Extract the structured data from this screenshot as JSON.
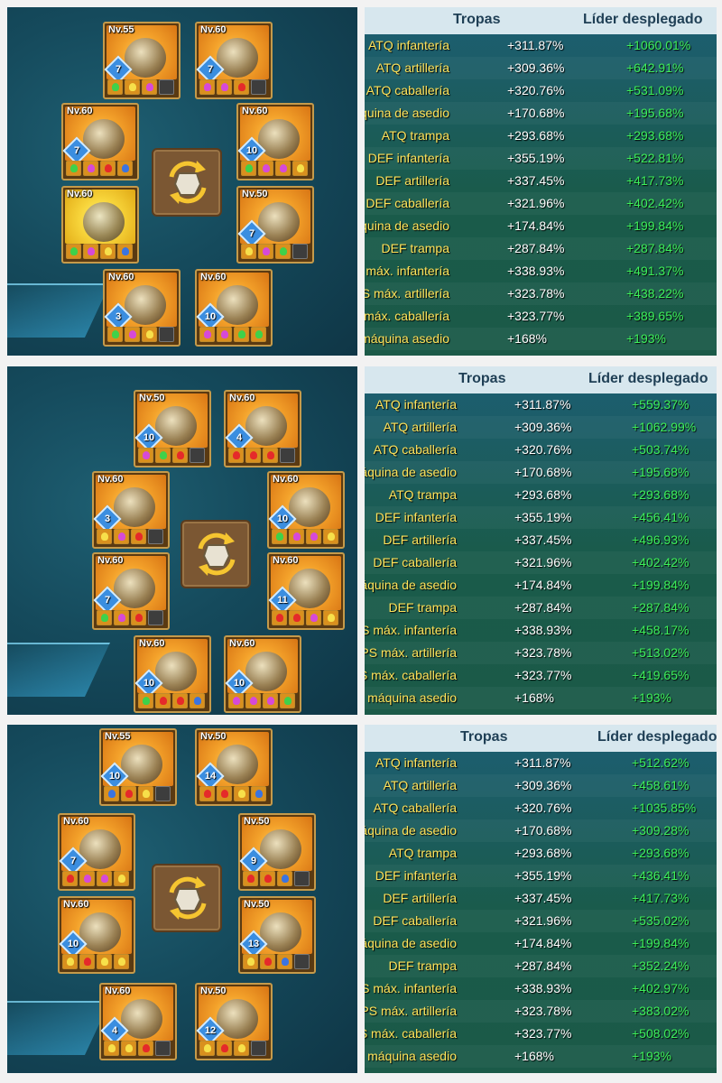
{
  "icons": {
    "swap": "swap-icon",
    "chest_armor": "armor-icon"
  },
  "colors": {
    "label": "#ffe35a",
    "troop_value": "#ffffff",
    "leader_value": "#3df05a",
    "header_text": "#1f3f55"
  },
  "panels": [
    {
      "slots": [
        {
          "level": "Nv.55",
          "stars": "7"
        },
        {
          "level": "Nv.60",
          "stars": "7"
        },
        {
          "level": "Nv.60",
          "stars": "7"
        },
        {
          "level": "Nv.60",
          "stars": "10"
        },
        {
          "level": "Nv.60",
          "stars": ""
        },
        {
          "level": "Nv.50",
          "stars": "7"
        },
        {
          "level": "Nv.60",
          "stars": "3"
        },
        {
          "level": "Nv.60",
          "stars": "10"
        }
      ],
      "table": {
        "header_troops": "Tropas",
        "header_leader": "Líder desplegado",
        "rows": [
          {
            "label": "ATQ infantería",
            "troops": "+311.87%",
            "leader": "+1060.01%"
          },
          {
            "label": "ATQ artillería",
            "troops": "+309.36%",
            "leader": "+642.91%"
          },
          {
            "label": "ATQ caballería",
            "troops": "+320.76%",
            "leader": "+531.09%"
          },
          {
            "label": "áquina de asedio",
            "troops": "+170.68%",
            "leader": "+195.68%"
          },
          {
            "label": "ATQ trampa",
            "troops": "+293.68%",
            "leader": "+293.68%"
          },
          {
            "label": "DEF infantería",
            "troops": "+355.19%",
            "leader": "+522.81%"
          },
          {
            "label": "DEF artillería",
            "troops": "+337.45%",
            "leader": "+417.73%"
          },
          {
            "label": "DEF caballería",
            "troops": "+321.96%",
            "leader": "+402.42%"
          },
          {
            "label": "áquina de asedio",
            "troops": "+174.84%",
            "leader": "+199.84%"
          },
          {
            "label": "DEF trampa",
            "troops": "+287.84%",
            "leader": "+287.84%"
          },
          {
            "label": "máx. infantería",
            "troops": "+338.93%",
            "leader": "+491.37%"
          },
          {
            "label": "PS máx. artillería",
            "troops": "+323.78%",
            "leader": "+438.22%"
          },
          {
            "label": "máx. caballería",
            "troops": "+323.77%",
            "leader": "+389.65%"
          },
          {
            "label": "máquina asedio",
            "troops": "+168%",
            "leader": "+193%"
          }
        ]
      }
    },
    {
      "slots": [
        {
          "level": "Nv.50",
          "stars": "10"
        },
        {
          "level": "Nv.60",
          "stars": "4"
        },
        {
          "level": "Nv.60",
          "stars": "3"
        },
        {
          "level": "Nv.60",
          "stars": "10"
        },
        {
          "level": "Nv.60",
          "stars": "7"
        },
        {
          "level": "Nv.60",
          "stars": "11"
        },
        {
          "level": "Nv.60",
          "stars": "10"
        },
        {
          "level": "Nv.60",
          "stars": "10"
        }
      ],
      "table": {
        "header_troops": "Tropas",
        "header_leader": "Líder desplegado",
        "rows": [
          {
            "label": "ATQ infantería",
            "troops": "+311.87%",
            "leader": "+559.37%"
          },
          {
            "label": "ATQ artillería",
            "troops": "+309.36%",
            "leader": "+1062.99%"
          },
          {
            "label": "ATQ caballería",
            "troops": "+320.76%",
            "leader": "+503.74%"
          },
          {
            "label": "áquina de asedio",
            "troops": "+170.68%",
            "leader": "+195.68%"
          },
          {
            "label": "ATQ trampa",
            "troops": "+293.68%",
            "leader": "+293.68%"
          },
          {
            "label": "DEF infantería",
            "troops": "+355.19%",
            "leader": "+456.41%"
          },
          {
            "label": "DEF artillería",
            "troops": "+337.45%",
            "leader": "+496.93%"
          },
          {
            "label": "DEF caballería",
            "troops": "+321.96%",
            "leader": "+402.42%"
          },
          {
            "label": "áquina de asedio",
            "troops": "+174.84%",
            "leader": "+199.84%"
          },
          {
            "label": "DEF trampa",
            "troops": "+287.84%",
            "leader": "+287.84%"
          },
          {
            "label": "PS máx. infantería",
            "troops": "+338.93%",
            "leader": "+458.17%"
          },
          {
            "label": "PS máx. artillería",
            "troops": "+323.78%",
            "leader": "+513.02%"
          },
          {
            "label": "PS máx. caballería",
            "troops": "+323.77%",
            "leader": "+419.65%"
          },
          {
            "label": "máquina asedio",
            "troops": "+168%",
            "leader": "+193%"
          }
        ]
      }
    },
    {
      "slots": [
        {
          "level": "Nv.55",
          "stars": "10"
        },
        {
          "level": "Nv.50",
          "stars": "14"
        },
        {
          "level": "Nv.60",
          "stars": "7"
        },
        {
          "level": "Nv.50",
          "stars": "9"
        },
        {
          "level": "Nv.60",
          "stars": "10"
        },
        {
          "level": "Nv.50",
          "stars": "13"
        },
        {
          "level": "Nv.60",
          "stars": "4"
        },
        {
          "level": "Nv.50",
          "stars": "12"
        }
      ],
      "table": {
        "header_troops": "Tropas",
        "header_leader": "Líder desplegado",
        "rows": [
          {
            "label": "ATQ infantería",
            "troops": "+311.87%",
            "leader": "+512.62%"
          },
          {
            "label": "ATQ artillería",
            "troops": "+309.36%",
            "leader": "+458.61%"
          },
          {
            "label": "ATQ caballería",
            "troops": "+320.76%",
            "leader": "+1035.85%"
          },
          {
            "label": "áquina de asedio",
            "troops": "+170.68%",
            "leader": "+309.28%"
          },
          {
            "label": "ATQ trampa",
            "troops": "+293.68%",
            "leader": "+293.68%"
          },
          {
            "label": "DEF infantería",
            "troops": "+355.19%",
            "leader": "+436.41%"
          },
          {
            "label": "DEF artillería",
            "troops": "+337.45%",
            "leader": "+417.73%"
          },
          {
            "label": "DEF caballería",
            "troops": "+321.96%",
            "leader": "+535.02%"
          },
          {
            "label": "áquina de asedio",
            "troops": "+174.84%",
            "leader": "+199.84%"
          },
          {
            "label": "DEF trampa",
            "troops": "+287.84%",
            "leader": "+352.24%"
          },
          {
            "label": "S máx. infantería",
            "troops": "+338.93%",
            "leader": "+402.97%"
          },
          {
            "label": "PS máx. artillería",
            "troops": "+323.78%",
            "leader": "+383.02%"
          },
          {
            "label": "S máx. caballería",
            "troops": "+323.77%",
            "leader": "+508.02%"
          },
          {
            "label": "máquina asedio",
            "troops": "+168%",
            "leader": "+193%"
          }
        ]
      }
    }
  ]
}
